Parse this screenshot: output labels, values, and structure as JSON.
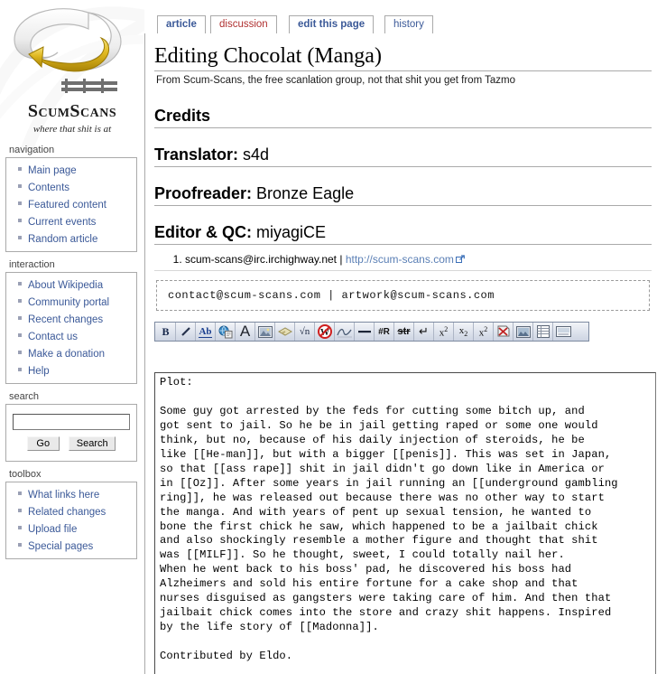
{
  "site": {
    "logo_wordmark": "ScumScans",
    "logo_tagline": "where that shit is at"
  },
  "tabs": [
    {
      "id": "article",
      "label": "article",
      "state": "normal",
      "color": "#3b5998"
    },
    {
      "id": "discussion",
      "label": "discussion",
      "state": "new",
      "color": "#b03030"
    },
    {
      "id": "edit",
      "label": "edit this page",
      "state": "selected",
      "color": "#3b5998"
    },
    {
      "id": "history",
      "label": "history",
      "state": "normal",
      "color": "#3b5998"
    }
  ],
  "sidebar": {
    "sections": [
      {
        "heading": "navigation",
        "items": [
          "Main page",
          "Contents",
          "Featured content",
          "Current events",
          "Random article"
        ]
      },
      {
        "heading": "interaction",
        "items": [
          "About Wikipedia",
          "Community portal",
          "Recent changes",
          "Contact us",
          "Make a donation",
          "Help"
        ]
      }
    ],
    "search": {
      "heading": "search",
      "value": "",
      "placeholder": "",
      "go_label": "Go",
      "search_label": "Search"
    },
    "toolbox": {
      "heading": "toolbox",
      "items": [
        "What links here",
        "Related changes",
        "Upload file",
        "Special pages"
      ]
    }
  },
  "page": {
    "title": "Editing Chocolat (Manga)",
    "subtitle": "From Scum-Scans, the free scanlation group, not that shit you get from Tazmo",
    "credits_heading": "Credits",
    "credits": [
      {
        "label": "Translator:",
        "value": "s4d"
      },
      {
        "label": "Proofreader:",
        "value": "Bronze Eagle"
      },
      {
        "label": "Editor & QC:",
        "value": "miyagiCE"
      }
    ],
    "irc_line": {
      "number": "1.",
      "channel": "scum-scans@irc.irchighway.net",
      "separator": "|",
      "link_text": "http://scum-scans.com"
    },
    "contact_box": "contact@scum-scans.com  |  artwork@scum-scans.com"
  },
  "edit_toolbar": {
    "buttons": [
      {
        "name": "bold-icon",
        "glyph": "B",
        "title": "Bold"
      },
      {
        "name": "italic-icon",
        "glyph": "I",
        "title": "Italic"
      },
      {
        "name": "internal-link-icon",
        "glyph": "Ab",
        "title": "Internal link"
      },
      {
        "name": "external-link-icon",
        "glyph": "",
        "title": "External link"
      },
      {
        "name": "headline-icon",
        "glyph": "A",
        "title": "Level 2 headline"
      },
      {
        "name": "embedded-image-icon",
        "glyph": "",
        "title": "Embedded image"
      },
      {
        "name": "media-file-icon",
        "glyph": "",
        "title": "Media file link"
      },
      {
        "name": "math-formula-icon",
        "glyph": "√n",
        "title": "Mathematical formula (LaTeX)"
      },
      {
        "name": "nowiki-icon",
        "glyph": "W",
        "title": "Ignore wiki formatting"
      },
      {
        "name": "signature-icon",
        "glyph": "",
        "title": "Your signature with timestamp"
      },
      {
        "name": "horizontal-line-icon",
        "glyph": "—",
        "title": "Horizontal line"
      },
      {
        "name": "redirect-icon",
        "glyph": "#R",
        "title": "Redirect"
      },
      {
        "name": "strikethrough-icon",
        "glyph": "s",
        "title": "Strike through"
      },
      {
        "name": "line-break-icon",
        "glyph": "↵",
        "title": "Line break"
      },
      {
        "name": "superscript-icon",
        "glyph": "x",
        "title": "Superscript"
      },
      {
        "name": "subscript-icon",
        "glyph": "x",
        "title": "Subscript"
      },
      {
        "name": "small-text-icon",
        "glyph": "x",
        "title": "Small text"
      },
      {
        "name": "hidden-comment-icon",
        "glyph": "",
        "title": "Insert hidden comment"
      },
      {
        "name": "picture-gallery-icon",
        "glyph": "",
        "title": "Insert a picture gallery"
      },
      {
        "name": "table-icon",
        "glyph": "",
        "title": "Insert table"
      },
      {
        "name": "reference-icon",
        "glyph": "",
        "title": "Insert reference"
      }
    ]
  },
  "editor": {
    "text": "Plot:\n\nSome guy got arrested by the feds for cutting some bitch up, and\ngot sent to jail. So he be in jail getting raped or some one would\nthink, but no, because of his daily injection of steroids, he be\nlike [[He-man]], but with a bigger [[penis]]. This was set in Japan,\nso that [[ass rape]] shit in jail didn't go down like in America or\nin [[Oz]]. After some years in jail running an [[underground gambling\nring]], he was released out because there was no other way to start\nthe manga. And with years of pent up sexual tension, he wanted to\nbone the first chick he saw, which happened to be a jailbait chick\nand also shockingly resemble a mother figure and thought that shit\nwas [[MILF]]. So he thought, sweet, I could totally nail her.\nWhen he went back to his boss' pad, he discovered his boss had\nAlzheimers and sold his entire fortune for a cake shop and that\nnurses disguised as gangsters were taking care of him. And then that\njailbait chick comes into the store and crazy shit happens. Inspired\nby the life story of [[Madonna]].\n\nContributed by Eldo.",
    "spellcheck_words": [
      "manga",
      "jailbait",
      "Alzheimers",
      "Eldo"
    ],
    "caret_after": "Contributed by Eldo."
  },
  "colors": {
    "link": "#3b5998",
    "new_link": "#b03030",
    "external_link": "#5a7fb5",
    "rule": "#aaaaaa",
    "toolbar_border": "#7d8aa0",
    "logo_gold": "#d4b021"
  }
}
